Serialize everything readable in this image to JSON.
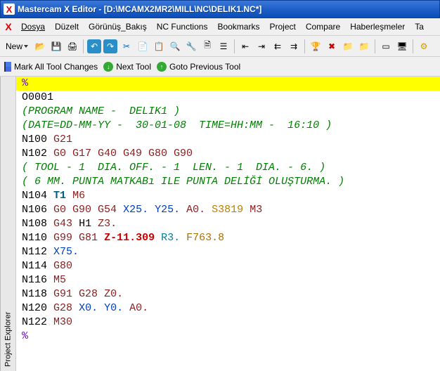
{
  "title": "Mastercam X Editor - [D:\\MCAMX2MR2\\MILL\\NC\\DELIK1.NC*]",
  "menu": {
    "dosya": "Dosya",
    "duzelt": "Düzelt",
    "gorunus": "Görünüş_Bakış",
    "nc": "NC Functions",
    "bookmarks": "Bookmarks",
    "project": "Project",
    "compare": "Compare",
    "haber": "Haberleşmeler",
    "ta": "Ta"
  },
  "toolbar": {
    "new": "New"
  },
  "toolbar2": {
    "mark": "Mark All Tool Changes",
    "next": "Next Tool",
    "prev": "Goto Previous Tool"
  },
  "sidebar": "Project Explorer",
  "code": {
    "l1": "%",
    "l2": "O0001",
    "l3": "(PROGRAM NAME -  DELIK1 )",
    "l4": "(DATE=DD-MM-YY -  30-01-08  TIME=HH:MM -  16:10 )",
    "l5a": "N100",
    "l5b": "G21",
    "l6a": "N102",
    "l6b": "G0 G17 G40 G49 G80 G90",
    "l7": "( TOOL - 1  DIA. OFF. - 1  LEN. - 1  DIA. - 6. )",
    "l8": "( 6 MM. PUNTA MATKABı ILE PUNTA DELİĞİ OLUŞTURMA. )",
    "l9a": "N104",
    "l9b": "T1",
    "l9c": "M6",
    "l10a": "N106",
    "l10b": "G0 G90 G54",
    "l10c": "X25.",
    "l10d": "Y25.",
    "l10e": "A0.",
    "l10f": "S3819",
    "l10g": "M3",
    "l11a": "N108",
    "l11b": "G43",
    "l11c": "H1",
    "l11d": "Z3.",
    "l12a": "N110",
    "l12b": "G99 G81",
    "l12c": "Z-11.309",
    "l12d": "R3.",
    "l12e": "F763.8",
    "l13a": "N112",
    "l13b": "X75.",
    "l14a": "N114",
    "l14b": "G80",
    "l15a": "N116",
    "l15b": "M5",
    "l16a": "N118",
    "l16b": "G91 G28",
    "l16c": "Z0.",
    "l17a": "N120",
    "l17b": "G28",
    "l17c": "X0.",
    "l17d": "Y0.",
    "l17e": "A0.",
    "l18a": "N122",
    "l18b": "M30",
    "l19": "%"
  }
}
